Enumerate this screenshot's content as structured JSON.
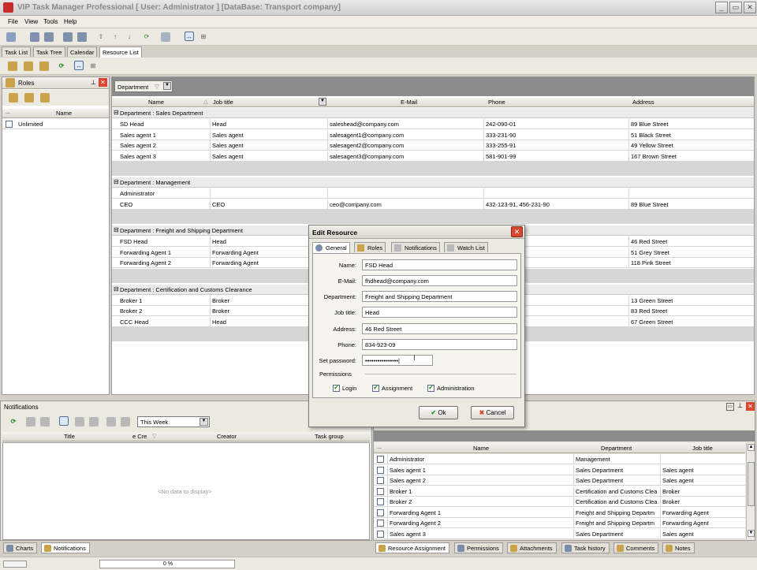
{
  "window": {
    "title": "VIP Task Manager Professional [ User: Administrator ] [DataBase: Transport company]",
    "min": "_",
    "max": "▭",
    "close": "✕"
  },
  "menu": [
    "File",
    "View",
    "Tools",
    "Help"
  ],
  "main_tabs": [
    "Task List",
    "Task Tree",
    "Calendar",
    "Resource List"
  ],
  "roles_panel": {
    "title": "Roles",
    "col_dots": "...",
    "col_name": "Name",
    "rows": [
      "Unlimited"
    ]
  },
  "grid": {
    "group_by": "Department",
    "columns": [
      "Name",
      "Job title",
      "E-Mail",
      "Phone",
      "Address"
    ],
    "groups": [
      {
        "label": "Department : Sales Department",
        "rows": [
          [
            "SD Head",
            "Head",
            "saleshead@company.com",
            "242-090-01",
            "89 Blue Street"
          ],
          [
            "Sales agent 1",
            "Sales agent",
            "salesagent1@company.com",
            "333-231-90",
            "51 Black Street"
          ],
          [
            "Sales agent 2",
            "Sales agent",
            "salesagent2@company.com",
            "333-255-91",
            "49 Yellow Street"
          ],
          [
            "Sales agent 3",
            "Sales agent",
            "salesagent3@company.com",
            "581-901-99",
            "167 Brown Street"
          ]
        ]
      },
      {
        "label": "Department : Management",
        "rows": [
          [
            "Administrator",
            "",
            "",
            "",
            ""
          ],
          [
            "CEO",
            "CEO",
            "ceo@company.com",
            "432-123-91, 456-231-90",
            "89 Blue Street"
          ]
        ]
      },
      {
        "label": "Department : Freight and Shipping Department",
        "rows": [
          [
            "FSD Head",
            "Head",
            "",
            "",
            "46 Red Street"
          ],
          [
            "Forwarding Agent 1",
            "Forwarding Agent",
            "",
            "",
            "51 Grey Street"
          ],
          [
            "Forwarding Agent 2",
            "Forwarding Agent",
            "",
            "",
            "118 Pink Street"
          ]
        ]
      },
      {
        "label": "Department : Certification and Customs Clearance",
        "rows": [
          [
            "Broker 1",
            "Broker",
            "",
            "",
            "13 Green Street"
          ],
          [
            "Broker 2",
            "Broker",
            "",
            "",
            "83 Red Street"
          ],
          [
            "CCC Head",
            "Head",
            "",
            "",
            "67 Green Street"
          ]
        ]
      }
    ]
  },
  "notifications": {
    "title": "Notifications",
    "period": "This Week",
    "columns": [
      "Title",
      "e Cre",
      "Creator",
      "Task group"
    ],
    "empty": "<No data to display>"
  },
  "bottom_left_tabs": [
    "Charts",
    "Notifications"
  ],
  "resource_assign": {
    "columns": [
      "...",
      "Name",
      "Department",
      "Job title"
    ],
    "rows": [
      [
        "Administrator",
        "Management",
        ""
      ],
      [
        "Sales agent 1",
        "Sales Department",
        "Sales agent"
      ],
      [
        "Sales agent 2",
        "Sales Department",
        "Sales agent"
      ],
      [
        "Broker 1",
        "Certification and Customs Clea",
        "Broker"
      ],
      [
        "Broker 2",
        "Certification and Customs Clea",
        "Broker"
      ],
      [
        "Forwarding Agent 1",
        "Freight and Shipping Departm",
        "Forwarding Agent"
      ],
      [
        "Forwarding Agent 2",
        "Freight and Shipping Departm",
        "Forwarding Agent"
      ],
      [
        "Sales agent 3",
        "Sales Department",
        "Sales agent"
      ]
    ]
  },
  "bottom_right_tabs": [
    "Resource Assignment",
    "Permissions",
    "Attachments",
    "Task history",
    "Comments",
    "Notes"
  ],
  "status": {
    "progress_label": "0 %",
    "progress": 0
  },
  "dialog": {
    "title": "Edit Resource",
    "tabs": [
      "General",
      "Roles",
      "Notifications",
      "Watch List"
    ],
    "fields": [
      {
        "label": "Name:",
        "value": "FSD Head"
      },
      {
        "label": "E-Mail:",
        "value": "fhdhead@company.com"
      },
      {
        "label": "Department:",
        "value": "Freight and Shipping Department"
      },
      {
        "label": "Job title:",
        "value": "Head"
      },
      {
        "label": "Address:",
        "value": "46 Red Street"
      },
      {
        "label": "Phone:",
        "value": "834-923-09"
      },
      {
        "label": "Set password:",
        "value": "••••••••••••••••|"
      }
    ],
    "permissions_label": "Permissions",
    "permissions": [
      {
        "label": "Login",
        "checked": true
      },
      {
        "label": "Assignment",
        "checked": true
      },
      {
        "label": "Administration",
        "checked": true
      }
    ],
    "ok": "Ok",
    "cancel": "Cancel",
    "close": "✕"
  },
  "colors": {
    "accent": "#3d6cc0",
    "close_red": "#d9452e",
    "ok_green": "#2a9a2a"
  }
}
